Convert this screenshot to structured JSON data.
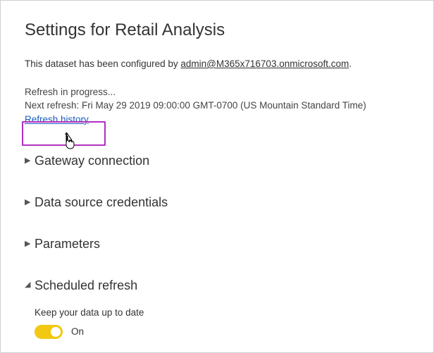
{
  "title_prefix": "Settings for ",
  "title_name": "Retail Analysis",
  "configured_prefix": "This dataset has been configured by ",
  "configured_admin": "admin@M365x716703.onmicrosoft.com",
  "configured_suffix": ".",
  "status": {
    "progress": "Refresh in progress...",
    "next_refresh": "Next refresh: Fri May 29 2019 09:00:00 GMT-0700 (US Mountain Standard Time)",
    "history_link": "Refresh history"
  },
  "sections": {
    "gateway": "Gateway connection",
    "credentials": "Data source credentials",
    "parameters": "Parameters",
    "scheduled": "Scheduled refresh"
  },
  "scheduled": {
    "keep_label": "Keep your data up to date",
    "toggle_state": "On"
  }
}
